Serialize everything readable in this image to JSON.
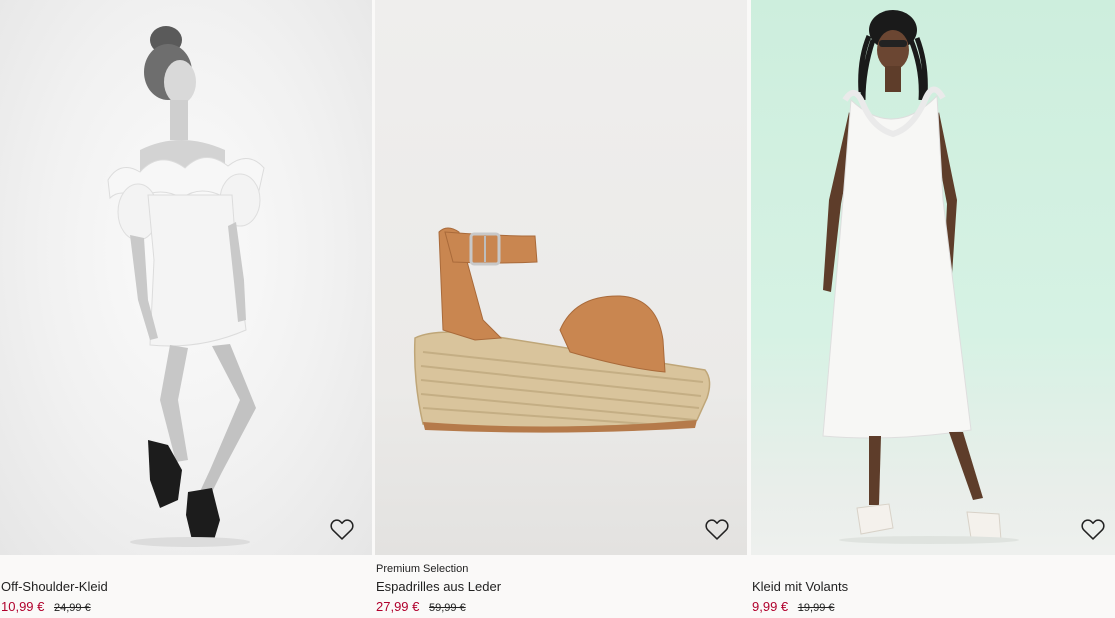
{
  "products": [
    {
      "badge": "",
      "title": "Off-Shoulder-Kleid",
      "price_sale": "10,99 €",
      "price_original": "24,99 €",
      "favorite_icon": "heart-outline-icon"
    },
    {
      "badge": "Premium Selection",
      "title": "Espadrilles aus Leder",
      "price_sale": "27,99 €",
      "price_original": "59,99 €",
      "favorite_icon": "heart-outline-icon"
    },
    {
      "badge": "",
      "title": "Kleid mit Volants",
      "price_sale": "9,99 €",
      "price_original": "19,99 €",
      "favorite_icon": "heart-outline-icon"
    }
  ],
  "colors": {
    "sale_price": "#b0002c",
    "background": "#faf9f8",
    "mint_backdrop": "#d6f2e4"
  }
}
